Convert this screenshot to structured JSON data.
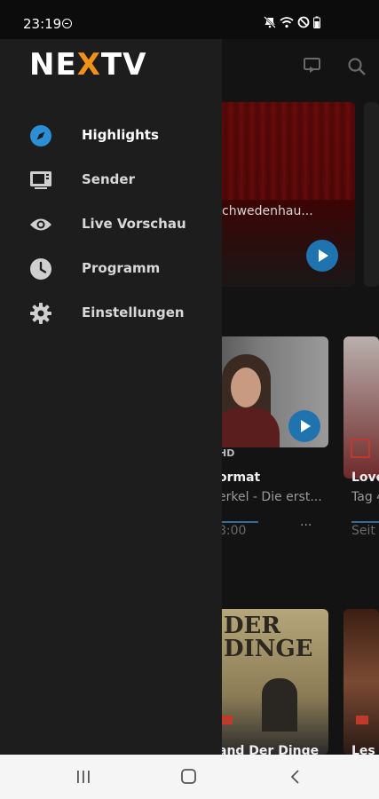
{
  "status_bar": {
    "time": "23:19",
    "icons": [
      "dnd-icon",
      "mute-icon",
      "wifi-icon",
      "block-icon",
      "battery-icon"
    ]
  },
  "app": {
    "logo": {
      "prefix": "NE",
      "accent": "X",
      "suffix": "TV",
      "accent_color": "#f29118"
    }
  },
  "drawer": {
    "items": [
      {
        "label": "Highlights",
        "icon": "compass-icon",
        "active": true
      },
      {
        "label": "Sender",
        "icon": "tv-icon"
      },
      {
        "label": "Live Vorschau",
        "icon": "eye-icon"
      },
      {
        "label": "Programm",
        "icon": "clock-icon"
      },
      {
        "label": "Einstellungen",
        "icon": "gear-icon"
      }
    ]
  },
  "background": {
    "hero_title": "chwedenhau...",
    "row1": {
      "card1": {
        "badge": "HD",
        "title": "ormat",
        "subtitle": "erkel - Die erst...",
        "time": "8:00",
        "more": "..."
      },
      "card2": {
        "title": "Love",
        "subtitle": "Tag 4",
        "time": "Seit"
      }
    },
    "row2": {
      "card1": {
        "poster_text_1": "DER",
        "poster_text_2": "DINGE",
        "title": "and Der Dinge"
      },
      "card2": {
        "title": "Les h"
      }
    }
  },
  "colors": {
    "accent_blue": "#1f74b0",
    "drawer_bg": "#1d1d1d",
    "active_icon": "#2c8fd6"
  }
}
